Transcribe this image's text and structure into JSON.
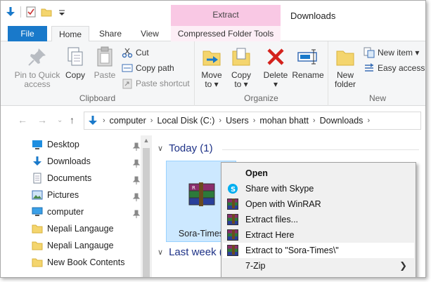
{
  "window": {
    "title": "Downloads"
  },
  "contextual_tab": {
    "label": "Extract"
  },
  "tabs": {
    "file": "File",
    "home": "Home",
    "share": "Share",
    "view": "View",
    "compressed": "Compressed Folder Tools"
  },
  "ribbon": {
    "clipboard": {
      "label": "Clipboard",
      "pin_line1": "Pin to Quick",
      "pin_line2": "access",
      "copy": "Copy",
      "paste": "Paste",
      "cut": "Cut",
      "copy_path": "Copy path",
      "paste_shortcut": "Paste shortcut"
    },
    "organize": {
      "label": "Organize",
      "move_line1": "Move",
      "move_line2": "to ▾",
      "copy_line1": "Copy",
      "copy_line2": "to ▾",
      "delete": "Delete",
      "delete_arrow": "▾",
      "rename": "Rename"
    },
    "new": {
      "label": "New",
      "new_folder_line1": "New",
      "new_folder_line2": "folder",
      "new_item": "New item ▾",
      "easy_access": "Easy access ▾"
    }
  },
  "address": {
    "crumbs": [
      "computer",
      "Local Disk (C:)",
      "Users",
      "mohan bhatt",
      "Downloads"
    ]
  },
  "nav": {
    "items": [
      {
        "label": "Desktop",
        "icon": "desktop-icon",
        "pinned": true
      },
      {
        "label": "Downloads",
        "icon": "download-icon",
        "pinned": true
      },
      {
        "label": "Documents",
        "icon": "documents-icon",
        "pinned": true
      },
      {
        "label": "Pictures",
        "icon": "pictures-icon",
        "pinned": true
      },
      {
        "label": "computer",
        "icon": "computer-icon",
        "pinned": true
      },
      {
        "label": "Nepali Langauge",
        "icon": "folder-icon",
        "pinned": false
      },
      {
        "label": "Nepali Langauge",
        "icon": "folder-icon",
        "pinned": false
      },
      {
        "label": "New Book Contents",
        "icon": "folder-icon",
        "pinned": false
      }
    ]
  },
  "content": {
    "group_today": "Today (1)",
    "group_last_week": "Last week (",
    "file_name": "Sora-Times"
  },
  "context_menu": {
    "items": [
      {
        "label": "Open",
        "icon": "",
        "bold": true
      },
      {
        "label": "Share with Skype",
        "icon": "skype-icon"
      },
      {
        "label": "Open with WinRAR",
        "icon": "winrar-icon"
      },
      {
        "label": "Extract files...",
        "icon": "winrar-icon"
      },
      {
        "label": "Extract Here",
        "icon": "winrar-icon"
      },
      {
        "label": "Extract to \"Sora-Times\\\"",
        "icon": "winrar-icon",
        "highlighted": true
      },
      {
        "label": "7-Zip",
        "icon": "",
        "submenu": "❯"
      }
    ]
  },
  "colors": {
    "accent": "#1979ca",
    "context_tab": "#f9c8e4",
    "selection": "#cce8ff",
    "group_header": "#1e3287"
  }
}
